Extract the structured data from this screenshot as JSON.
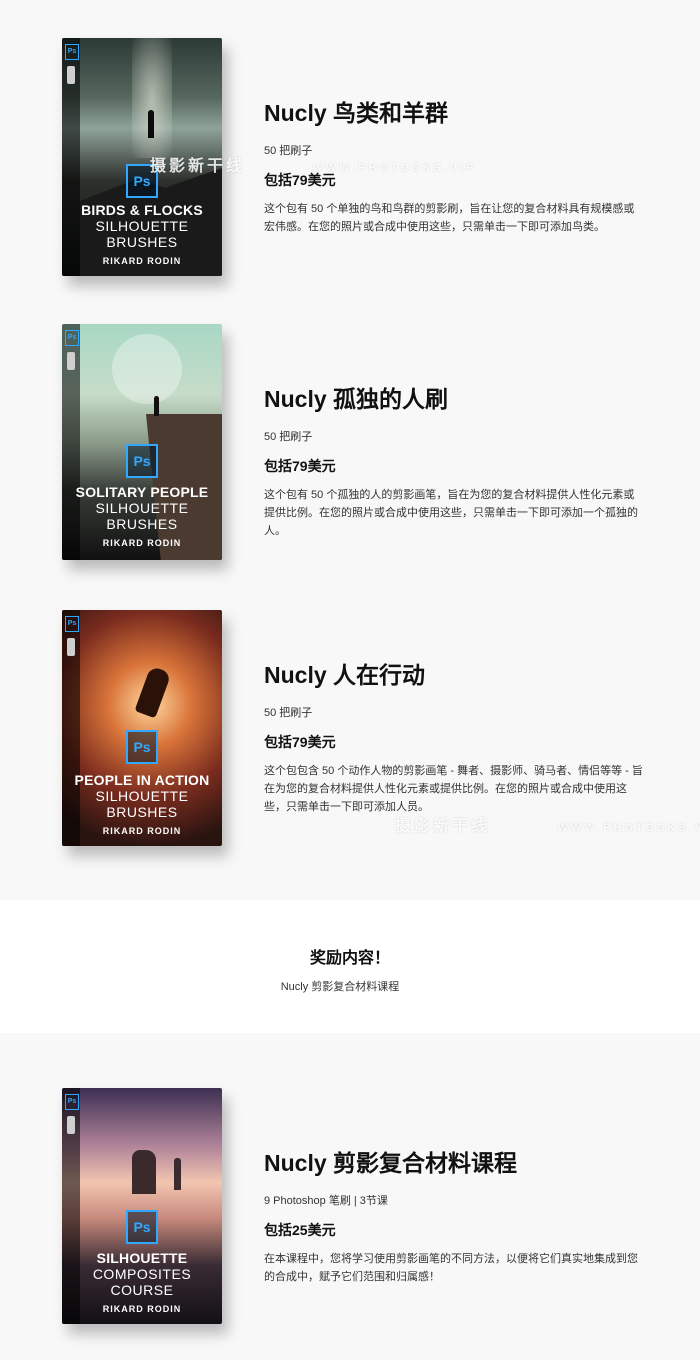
{
  "products": [
    {
      "title": "Nucly 鸟类和羊群",
      "count": "50 把刷子",
      "price": "包括79美元",
      "desc": "这个包有 50 个单独的鸟和鸟群的剪影刷，旨在让您的复合材料具有规模感或宏伟感。在您的照片或合成中使用这些，只需单击一下即可添加鸟类。",
      "box": {
        "title": "BIRDS & FLOCKS",
        "sub1": "SILHOUETTE",
        "sub2": "BRUSHES",
        "author": "RIKARD RODIN",
        "ps": "Ps"
      }
    },
    {
      "title": "Nucly 孤独的人刷",
      "count": "50 把刷子",
      "price": "包括79美元",
      "desc": "这个包有 50 个孤独的人的剪影画笔，旨在为您的复合材料提供人性化元素或提供比例。在您的照片或合成中使用这些，只需单击一下即可添加一个孤独的人。",
      "box": {
        "title": "SOLITARY PEOPLE",
        "sub1": "SILHOUETTE",
        "sub2": "BRUSHES",
        "author": "RIKARD RODIN",
        "ps": "Ps"
      }
    },
    {
      "title": "Nucly 人在行动",
      "count": "50 把刷子",
      "price": "包括79美元",
      "desc": "这个包包含 50 个动作人物的剪影画笔 - 舞者、摄影师、骑马者、情侣等等 - 旨在为您的复合材料提供人性化元素或提供比例。在您的照片或合成中使用这些，只需单击一下即可添加人员。",
      "box": {
        "title": "PEOPLE IN ACTION",
        "sub1": "SILHOUETTE",
        "sub2": "BRUSHES",
        "author": "RIKARD RODIN",
        "ps": "Ps"
      }
    },
    {
      "title": "Nucly 剪影复合材料课程",
      "count": "9 Photoshop 笔刷 | 3节课",
      "price": "包括25美元",
      "desc": "在本课程中，您将学习使用剪影画笔的不同方法，以便将它们真实地集成到您的合成中，赋予它们范围和归属感！",
      "box": {
        "title": "SILHOUETTE",
        "sub1": "COMPOSITES",
        "sub2": "COURSE",
        "author": "RIKARD RODIN",
        "ps": "Ps"
      }
    }
  ],
  "bonus": {
    "title": "奖励内容！",
    "subtitle": "Nucly 剪影复合材料课程"
  },
  "watermark": {
    "text1": "摄影新干线",
    "text2": "WWW.PHOTOSKS.VIP"
  }
}
